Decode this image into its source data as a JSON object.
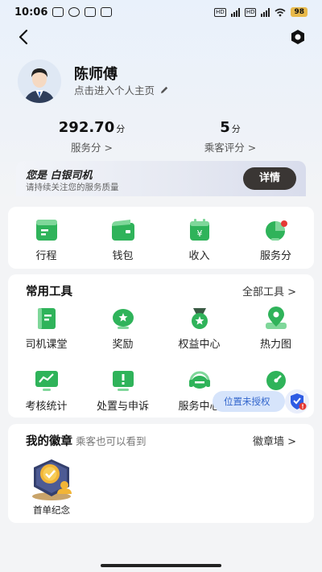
{
  "status": {
    "time": "10:06",
    "battery": "98"
  },
  "profile": {
    "name": "陈师傅",
    "link": "点击进入个人主页"
  },
  "stats": [
    {
      "value": "292.70",
      "unit": "分",
      "label": "服务分 >"
    },
    {
      "value": "5",
      "unit": "分",
      "label": "乘客评分 >"
    }
  ],
  "level": {
    "prefix": "您是",
    "title": "白银司机",
    "subtitle": "请持续关注您的服务质量",
    "button": "详情"
  },
  "main_actions": [
    {
      "label": "行程",
      "icon": "itinerary-icon"
    },
    {
      "label": "钱包",
      "icon": "wallet-icon"
    },
    {
      "label": "收入",
      "icon": "income-icon"
    },
    {
      "label": "服务分",
      "icon": "service-score-icon"
    }
  ],
  "tools": {
    "title": "常用工具",
    "link": "全部工具 >",
    "items": [
      {
        "label": "司机课堂",
        "icon": "driver-class-icon"
      },
      {
        "label": "奖励",
        "icon": "reward-icon"
      },
      {
        "label": "权益中心",
        "icon": "benefits-icon"
      },
      {
        "label": "热力图",
        "icon": "heatmap-icon"
      },
      {
        "label": "考核统计",
        "icon": "assessment-icon"
      },
      {
        "label": "处置与申诉",
        "icon": "appeal-icon"
      },
      {
        "label": "服务中心",
        "icon": "service-center-icon"
      },
      {
        "label": "",
        "icon": "gauge-icon"
      }
    ]
  },
  "location_pill": "位置未授权",
  "badges": {
    "title": "我的徽章",
    "hint": "乘客也可以看到",
    "link": "徽章墙 >",
    "items": [
      {
        "label": "首单纪念"
      }
    ]
  },
  "colors": {
    "accent_green": "#2fb35a",
    "light_green": "#7fd79a",
    "dark_button": "#3a3634",
    "pill_text": "#3366cc"
  }
}
